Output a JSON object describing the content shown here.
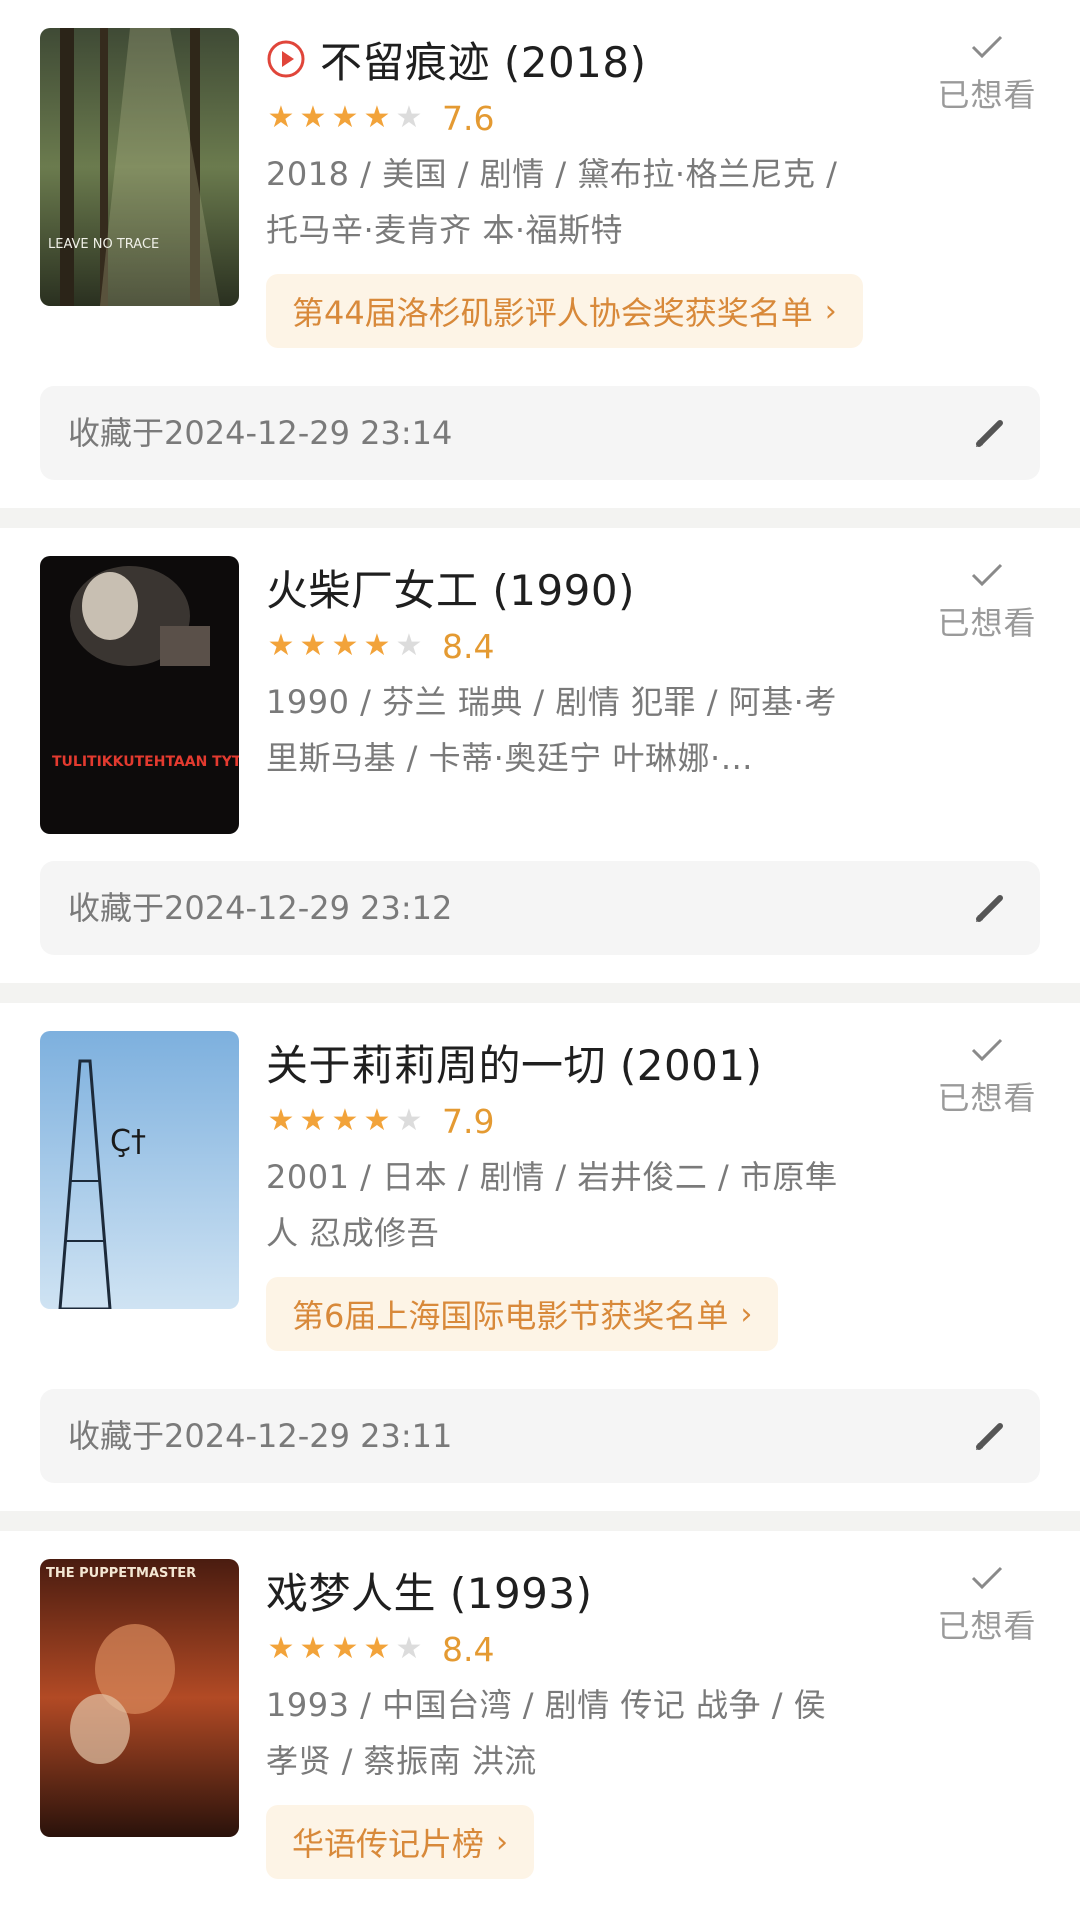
{
  "status_label": "已想看",
  "collected_prefix": "收藏于",
  "colors": {
    "star_on": "#f2a33a",
    "star_off": "#dcdcdc",
    "award_bg": "#fdf4e6",
    "award_text": "#d8893a"
  },
  "items": [
    {
      "title": "不留痕迹 (2018)",
      "has_play_icon": true,
      "rating_stars": 4,
      "score": "7.6",
      "meta": "2018 / 美国 / 剧情 / 黛布拉·格兰尼克 / 托马辛·麦肯齐 本·福斯特",
      "award": "第44届洛杉矶影评人协会奖获奖名单",
      "collected": "收藏于2024-12-29 23:14",
      "poster_text": "LEAVE NO TRACE"
    },
    {
      "title": "火柴厂女工 (1990)",
      "has_play_icon": false,
      "rating_stars": 4,
      "score": "8.4",
      "meta": "1990 / 芬兰 瑞典 / 剧情 犯罪 / 阿基·考里斯马基 / 卡蒂·奥廷宁 叶琳娜·…",
      "award": "",
      "collected": "收藏于2024-12-29 23:12",
      "poster_text": "TULITIKKUTEHTAAN TYTTÖ"
    },
    {
      "title": "关于莉莉周的一切 (2001)",
      "has_play_icon": false,
      "rating_stars": 4,
      "score": "7.9",
      "meta": "2001 / 日本 / 剧情 / 岩井俊二 / 市原隼人 忍成修吾",
      "award": "第6届上海国际电影节获奖名单",
      "collected": "收藏于2024-12-29 23:11",
      "poster_text": "Ç†"
    },
    {
      "title": "戏梦人生 (1993)",
      "has_play_icon": false,
      "rating_stars": 4,
      "score": "8.4",
      "meta": "1993 / 中国台湾 / 剧情 传记 战争 / 侯孝贤 / 蔡振南 洪流",
      "award": "华语传记片榜",
      "collected": "",
      "poster_text": "THE PUPPETMASTER"
    }
  ]
}
